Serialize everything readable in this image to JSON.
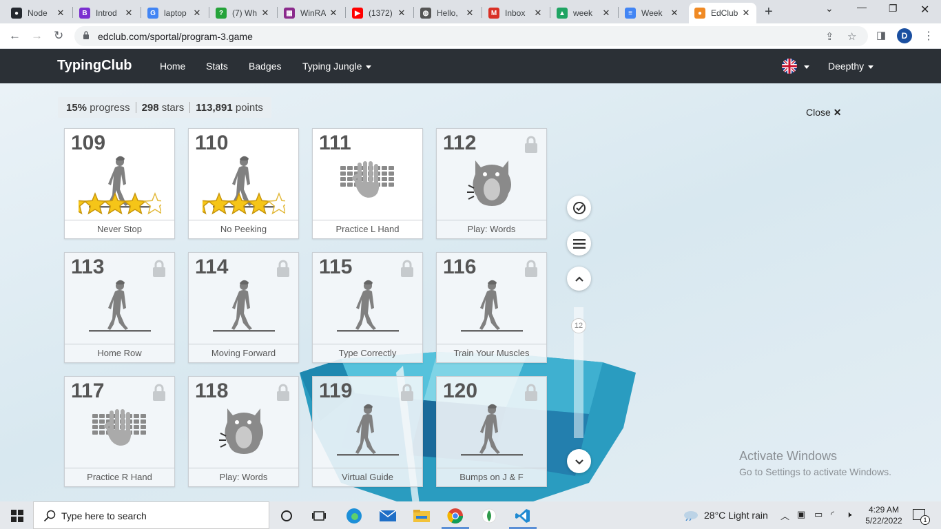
{
  "browser": {
    "tabs": [
      {
        "title": "Node",
        "color": "#24292f",
        "glyph": "●"
      },
      {
        "title": "Introd",
        "color": "#7b2fd0",
        "glyph": "B"
      },
      {
        "title": "laptop",
        "color": "#4285f4",
        "glyph": "G"
      },
      {
        "title": "(7) Wh",
        "color": "#25a33a",
        "glyph": "?"
      },
      {
        "title": "WinRA",
        "color": "#8b2a8c",
        "glyph": "▦"
      },
      {
        "title": "(1372)",
        "color": "#ff0000",
        "glyph": "▶"
      },
      {
        "title": "Hello,",
        "color": "#555555",
        "glyph": "◍"
      },
      {
        "title": "Inbox",
        "color": "#d93025",
        "glyph": "M"
      },
      {
        "title": "week",
        "color": "#1fa463",
        "glyph": "▲"
      },
      {
        "title": "Week",
        "color": "#4285f4",
        "glyph": "≡"
      },
      {
        "title": "EdClub",
        "color": "#f08a24",
        "glyph": "●"
      }
    ],
    "url": "edclub.com/sportal/program-3.game",
    "profile_initial": "D"
  },
  "site": {
    "brand": "TypingClub",
    "nav": [
      "Home",
      "Stats",
      "Badges",
      "Typing Jungle"
    ],
    "user": "Deepthy"
  },
  "stats": {
    "progress_value": "15%",
    "progress_label": "progress",
    "stars_value": "298",
    "stars_label": "stars",
    "points_value": "113,891",
    "points_label": "points"
  },
  "close_label": "Close",
  "lessons": [
    {
      "num": "109",
      "title": "Never Stop",
      "kind": "walker",
      "locked": false,
      "stars": 4
    },
    {
      "num": "110",
      "title": "No Peeking",
      "kind": "walker",
      "locked": false,
      "stars": 4
    },
    {
      "num": "111",
      "title": "Practice L Hand",
      "kind": "keyboard",
      "locked": false,
      "stars": 0
    },
    {
      "num": "112",
      "title": "Play: Words",
      "kind": "monster",
      "locked": true,
      "stars": 0
    },
    {
      "num": "113",
      "title": "Home Row",
      "kind": "walker",
      "locked": true,
      "stars": 0
    },
    {
      "num": "114",
      "title": "Moving Forward",
      "kind": "walker",
      "locked": true,
      "stars": 0
    },
    {
      "num": "115",
      "title": "Type Correctly",
      "kind": "walker",
      "locked": true,
      "stars": 0
    },
    {
      "num": "116",
      "title": "Train Your Muscles",
      "kind": "walker",
      "locked": true,
      "stars": 0
    },
    {
      "num": "117",
      "title": "Practice R Hand",
      "kind": "keyboard",
      "locked": true,
      "stars": 0
    },
    {
      "num": "118",
      "title": "Play: Words",
      "kind": "monster",
      "locked": true,
      "stars": 0
    },
    {
      "num": "119",
      "title": "Virtual Guide",
      "kind": "walker",
      "locked": true,
      "stars": 0
    },
    {
      "num": "120",
      "title": "Bumps on J & F",
      "kind": "walker",
      "locked": true,
      "stars": 0
    }
  ],
  "scroll_badge": "12",
  "watermark": {
    "line1": "Activate Windows",
    "line2": "Go to Settings to activate Windows."
  },
  "taskbar": {
    "search_placeholder": "Type here to search",
    "weather": "28°C  Light rain",
    "time": "4:29 AM",
    "date": "5/22/2022",
    "notification_count": "1"
  }
}
